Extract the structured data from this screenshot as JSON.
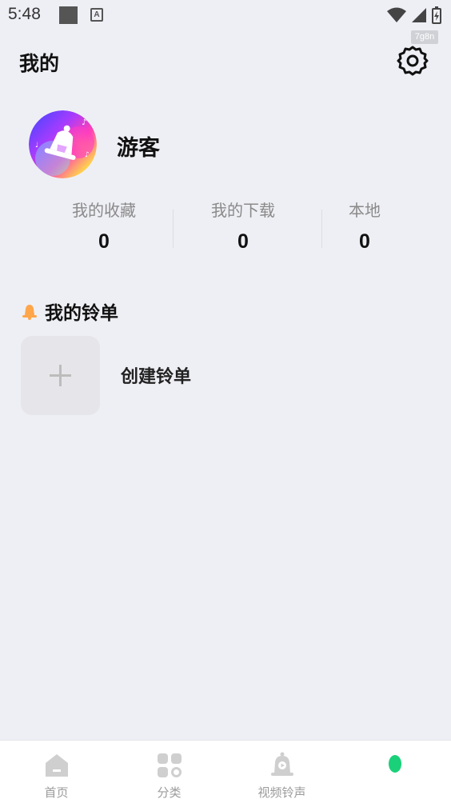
{
  "status_bar": {
    "time": "5:48",
    "a_icon_text": "A",
    "tag": "7g8n"
  },
  "header": {
    "title": "我的",
    "settings_icon": "gear-icon"
  },
  "profile": {
    "username": "游客",
    "avatar_icon": "bell-avatar-icon"
  },
  "stats": [
    {
      "label": "我的收藏",
      "value": "0"
    },
    {
      "label": "我的下载",
      "value": "0"
    },
    {
      "label": "本地",
      "value": "0"
    }
  ],
  "ringtone_list": {
    "title": "我的铃单",
    "icon": "bell-icon",
    "create_label": "创建铃单"
  },
  "bottom_nav": [
    {
      "label": "首页",
      "icon": "home-icon"
    },
    {
      "label": "分类",
      "icon": "category-icon"
    },
    {
      "label": "视频铃声",
      "icon": "video-bell-icon"
    },
    {
      "label": "",
      "icon": "mine-dot-icon"
    }
  ],
  "colors": {
    "background": "#eeeff4",
    "accent_green": "#1ad17a",
    "bell_orange": "#ffa54a"
  }
}
